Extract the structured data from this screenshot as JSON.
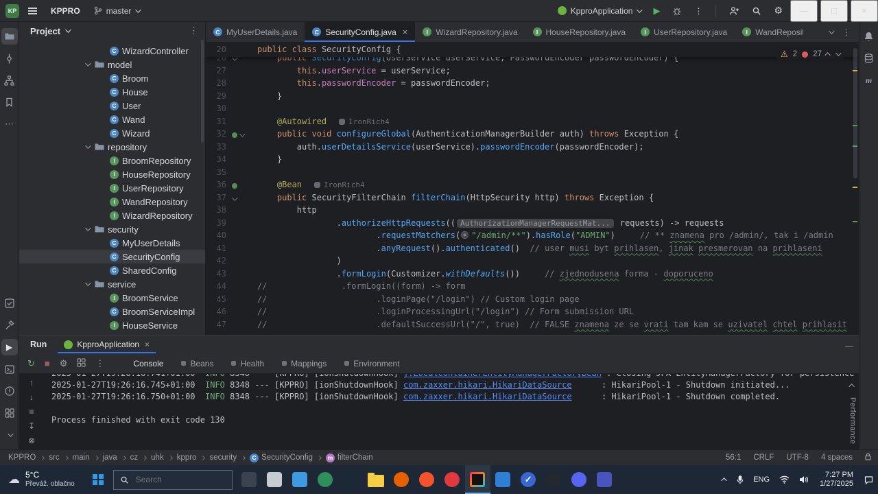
{
  "titlebar": {
    "logo": "KP",
    "project": "KPPRO",
    "branch": "master",
    "run_config": "KpproApplication"
  },
  "left_stripe": {
    "top": [
      "project",
      "commit",
      "structure",
      "bookmarks",
      "more"
    ],
    "bottom": [
      "todo",
      "build",
      "run",
      "terminal",
      "problems",
      "services",
      "hide"
    ]
  },
  "right_stripe": [
    "notifications",
    "database",
    "maven"
  ],
  "project_panel": {
    "title": "Project",
    "tree": [
      {
        "label": "WizardController",
        "icon": "class",
        "level": 2
      },
      {
        "label": "model",
        "icon": "folder",
        "level": 1,
        "expanded": true
      },
      {
        "label": "Broom",
        "icon": "class",
        "level": 2
      },
      {
        "label": "House",
        "icon": "class",
        "level": 2
      },
      {
        "label": "User",
        "icon": "class",
        "level": 2
      },
      {
        "label": "Wand",
        "icon": "class",
        "level": 2
      },
      {
        "label": "Wizard",
        "icon": "class",
        "level": 2
      },
      {
        "label": "repository",
        "icon": "folder",
        "level": 1,
        "expanded": true
      },
      {
        "label": "BroomRepository",
        "icon": "interface",
        "level": 2
      },
      {
        "label": "HouseRepository",
        "icon": "interface",
        "level": 2
      },
      {
        "label": "UserRepository",
        "icon": "interface",
        "level": 2
      },
      {
        "label": "WandRepository",
        "icon": "interface",
        "level": 2
      },
      {
        "label": "WizardRepository",
        "icon": "interface",
        "level": 2
      },
      {
        "label": "security",
        "icon": "folder",
        "level": 1,
        "expanded": true
      },
      {
        "label": "MyUserDetails",
        "icon": "class",
        "level": 2
      },
      {
        "label": "SecurityConfig",
        "icon": "class",
        "level": 2,
        "selected": true
      },
      {
        "label": "SharedConfig",
        "icon": "class",
        "level": 2
      },
      {
        "label": "service",
        "icon": "folder",
        "level": 1,
        "expanded": true
      },
      {
        "label": "BroomService",
        "icon": "interface",
        "level": 2
      },
      {
        "label": "BroomServiceImpl",
        "icon": "class",
        "level": 2
      },
      {
        "label": "HouseService",
        "icon": "interface",
        "level": 2
      }
    ]
  },
  "editor": {
    "tabs": [
      {
        "label": "MyUserDetails.java",
        "icon": "class"
      },
      {
        "label": "SecurityConfig.java",
        "icon": "class",
        "active": true,
        "close": true
      },
      {
        "label": "WizardRepository.java",
        "icon": "interface"
      },
      {
        "label": "HouseRepository.java",
        "icon": "interface"
      },
      {
        "label": "UserRepository.java",
        "icon": "interface"
      },
      {
        "label": "WandRepository.java",
        "icon": "interface",
        "clipped": true
      }
    ],
    "inspections": {
      "warnings": "2",
      "errors": "27"
    },
    "sticky": {
      "num": "20",
      "segs": [
        [
          "k",
          "public"
        ],
        [
          "d",
          " "
        ],
        [
          "k",
          "class"
        ],
        [
          "d",
          " SecurityConfig {"
        ]
      ]
    },
    "lines": [
      {
        "num": "26",
        "gutter": [
          "fold"
        ],
        "segs": [
          [
            "d",
            "    "
          ],
          [
            "k",
            "public"
          ],
          [
            "d",
            " "
          ],
          [
            "m",
            "SecurityConfig"
          ],
          [
            "d",
            "("
          ],
          [
            "t",
            "UserService"
          ],
          [
            "d",
            " userService, "
          ],
          [
            "t",
            "PasswordEncoder"
          ],
          [
            "d",
            " passwordEncoder) {"
          ]
        ]
      },
      {
        "num": "27",
        "segs": [
          [
            "d",
            "        "
          ],
          [
            "k",
            "this"
          ],
          [
            "d",
            "."
          ],
          [
            "f",
            "userService"
          ],
          [
            "d",
            " = userService;"
          ]
        ]
      },
      {
        "num": "28",
        "segs": [
          [
            "d",
            "        "
          ],
          [
            "k",
            "this"
          ],
          [
            "d",
            "."
          ],
          [
            "f",
            "passwordEncoder"
          ],
          [
            "d",
            " = passwordEncoder;"
          ]
        ]
      },
      {
        "num": "29",
        "segs": [
          [
            "d",
            "    }"
          ]
        ]
      },
      {
        "num": "30",
        "segs": []
      },
      {
        "num": "31",
        "author": "IronRich4",
        "segs": [
          [
            "d",
            "    "
          ],
          [
            "a",
            "@Autowired"
          ]
        ]
      },
      {
        "num": "32",
        "gutter": [
          "bean",
          "fold"
        ],
        "segs": [
          [
            "d",
            "    "
          ],
          [
            "k",
            "public"
          ],
          [
            "d",
            " "
          ],
          [
            "k",
            "void"
          ],
          [
            "d",
            " "
          ],
          [
            "m",
            "configureGlobal"
          ],
          [
            "d",
            "("
          ],
          [
            "t",
            "AuthenticationManagerBuilder"
          ],
          [
            "d",
            " auth) "
          ],
          [
            "k",
            "throws"
          ],
          [
            "d",
            " "
          ],
          [
            "t",
            "Exception"
          ],
          [
            "d",
            " {"
          ]
        ]
      },
      {
        "num": "33",
        "segs": [
          [
            "d",
            "        auth."
          ],
          [
            "m",
            "userDetailsService"
          ],
          [
            "d",
            "(userService)."
          ],
          [
            "m",
            "passwordEncoder"
          ],
          [
            "d",
            "(passwordEncoder);"
          ]
        ]
      },
      {
        "num": "34",
        "segs": [
          [
            "d",
            "    }"
          ]
        ]
      },
      {
        "num": "35",
        "segs": []
      },
      {
        "num": "36",
        "author": "IronRich4",
        "gutter": [
          "bean"
        ],
        "segs": [
          [
            "d",
            "    "
          ],
          [
            "a",
            "@Bean"
          ]
        ]
      },
      {
        "num": "37",
        "gutter": [
          "fold"
        ],
        "segs": [
          [
            "d",
            "    "
          ],
          [
            "k",
            "public"
          ],
          [
            "d",
            " "
          ],
          [
            "t",
            "SecurityFilterChain"
          ],
          [
            "d",
            " "
          ],
          [
            "m",
            "filterChain"
          ],
          [
            "d",
            "("
          ],
          [
            "t",
            "HttpSecurity"
          ],
          [
            "d",
            " http) "
          ],
          [
            "k",
            "throws"
          ],
          [
            "d",
            " "
          ],
          [
            "t",
            "Exception"
          ],
          [
            "d",
            " {"
          ]
        ]
      },
      {
        "num": "38",
        "segs": [
          [
            "d",
            "        http"
          ]
        ]
      },
      {
        "num": "39",
        "segs": [
          [
            "d",
            "                ."
          ],
          [
            "m",
            "authorizeHttpRequests"
          ],
          [
            "d",
            "(("
          ],
          [
            "hint",
            "AuthorizationManagerRequestMat..."
          ],
          [
            "d",
            " requests) -> requests"
          ]
        ]
      },
      {
        "num": "40",
        "segs": [
          [
            "d",
            "                        ."
          ],
          [
            "m",
            "requestMatchers"
          ],
          [
            "d",
            "("
          ],
          [
            "url",
            ""
          ],
          [
            "s",
            "\"/admin/**\""
          ],
          [
            "d",
            ")."
          ],
          [
            "m",
            "hasRole"
          ],
          [
            "d",
            "("
          ],
          [
            "s",
            "\"ADMIN\""
          ],
          [
            "d",
            ")     "
          ],
          [
            "c",
            "// ** "
          ],
          [
            "cu",
            "znamena"
          ],
          [
            "c",
            " pro /admin/, tak i /admin"
          ]
        ]
      },
      {
        "num": "41",
        "segs": [
          [
            "d",
            "                        ."
          ],
          [
            "m",
            "anyRequest"
          ],
          [
            "d",
            "()."
          ],
          [
            "m",
            "authenticated"
          ],
          [
            "d",
            "()  "
          ],
          [
            "c",
            "// user "
          ],
          [
            "cu",
            "musi"
          ],
          [
            "c",
            " byt "
          ],
          [
            "cu",
            "prihlasen"
          ],
          [
            "c",
            ", "
          ],
          [
            "cu",
            "jinak"
          ],
          [
            "c",
            " "
          ],
          [
            "cu",
            "presmerovan"
          ],
          [
            "c",
            " na "
          ],
          [
            "cu",
            "prihlaseni"
          ]
        ]
      },
      {
        "num": "42",
        "segs": [
          [
            "d",
            "                )"
          ]
        ]
      },
      {
        "num": "43",
        "segs": [
          [
            "d",
            "                ."
          ],
          [
            "m",
            "formLogin"
          ],
          [
            "d",
            "("
          ],
          [
            "t",
            "Customizer"
          ],
          [
            "d",
            "."
          ],
          [
            "ms",
            "withDefaults"
          ],
          [
            "d",
            "())     "
          ],
          [
            "c",
            "// "
          ],
          [
            "cu",
            "zjednodusena"
          ],
          [
            "c",
            " forma - "
          ],
          [
            "cu",
            "doporuceno"
          ]
        ]
      },
      {
        "num": "44",
        "segs": [
          [
            "c",
            "//               .formLogin((form) -> form"
          ]
        ]
      },
      {
        "num": "45",
        "segs": [
          [
            "c",
            "//                      .loginPage(\"/login\") // Custom login page"
          ]
        ]
      },
      {
        "num": "46",
        "segs": [
          [
            "c",
            "//                      .loginProcessingUrl(\"/login\") // Form submission URL"
          ]
        ]
      },
      {
        "num": "47",
        "segs": [
          [
            "c",
            "//                      .defaultSuccessUrl(\"/\", true)  // FALSE "
          ],
          [
            "cu",
            "znamena"
          ],
          [
            "c",
            " ze se "
          ],
          [
            "cu",
            "vrati"
          ],
          [
            "c",
            " tam kam se "
          ],
          [
            "cu",
            "uzivatel"
          ],
          [
            "c",
            " "
          ],
          [
            "cu",
            "chtel"
          ],
          [
            "c",
            " "
          ],
          [
            "cu",
            "prihlasit"
          ]
        ]
      }
    ]
  },
  "run_panel": {
    "label": "Run",
    "tab": "KpproApplication",
    "tabs": [
      {
        "label": "Console",
        "active": true
      },
      {
        "label": "Beans",
        "dot": true
      },
      {
        "label": "Health",
        "dot": true
      },
      {
        "label": "Mappings",
        "dot": true
      },
      {
        "label": "Environment",
        "dot": true
      }
    ],
    "performance_label": "Performance",
    "console": [
      {
        "clip": true,
        "segs": [
          [
            "t",
            "2025-01-27T19:26:16.741+01:00  "
          ],
          [
            "i",
            "INFO"
          ],
          [
            "t",
            " 8348 --- [KPPRO] [ionShutdownHook] "
          ],
          [
            "l",
            "j.LocalContainerEntityManagerFactoryBean"
          ],
          [
            "t",
            " : Closing JPA EntityManagerFactory for persistence unit 'default'"
          ]
        ]
      },
      {
        "segs": [
          [
            "t",
            "2025-01-27T19:26:16.745+01:00  "
          ],
          [
            "i",
            "INFO"
          ],
          [
            "t",
            " 8348 --- [KPPRO] [ionShutdownHook] "
          ],
          [
            "l",
            "com.zaxxer.hikari.HikariDataSource"
          ],
          [
            "t",
            "      : HikariPool-1 - Shutdown initiated..."
          ]
        ]
      },
      {
        "segs": [
          [
            "t",
            "2025-01-27T19:26:16.750+01:00  "
          ],
          [
            "i",
            "INFO"
          ],
          [
            "t",
            " 8348 --- [KPPRO] [ionShutdownHook] "
          ],
          [
            "l",
            "com.zaxxer.hikari.HikariDataSource"
          ],
          [
            "t",
            "      : HikariPool-1 - Shutdown completed."
          ]
        ]
      },
      {
        "segs": []
      },
      {
        "segs": [
          [
            "t",
            "Process finished with exit code 130"
          ]
        ]
      }
    ]
  },
  "status_bar": {
    "breadcrumbs": [
      {
        "label": "KPPRO"
      },
      {
        "label": "src"
      },
      {
        "label": "main"
      },
      {
        "label": "java"
      },
      {
        "label": "cz"
      },
      {
        "label": "uhk"
      },
      {
        "label": "kppro"
      },
      {
        "label": "security"
      },
      {
        "label": "SecurityConfig",
        "icon": "class"
      },
      {
        "label": "filterChain",
        "icon": "method"
      }
    ],
    "right": [
      "56:1",
      "CRLF",
      "UTF-8",
      "4 spaces"
    ]
  },
  "taskbar": {
    "weather": {
      "temp": "5°C",
      "desc": "Převáž. oblačno"
    },
    "search_placeholder": "Search",
    "apps": [
      {
        "name": "remote-desktop",
        "kind": "square",
        "color": "#3b4350"
      },
      {
        "name": "camera-app",
        "kind": "square",
        "color": "#c7ccd3"
      },
      {
        "name": "mail-app",
        "kind": "square",
        "color": "#3f9be0"
      },
      {
        "name": "recorder-app",
        "kind": "circle",
        "color": "#2f8f5b"
      },
      {
        "name": "steam",
        "kind": "circle",
        "color": "#1b2838"
      },
      {
        "name": "file-explorer",
        "kind": "folder",
        "color": "#f6ce46"
      },
      {
        "name": "firefox",
        "kind": "circle",
        "color": "#e66000"
      },
      {
        "name": "brave",
        "kind": "circle",
        "color": "#f3542d"
      },
      {
        "name": "opera",
        "kind": "circle",
        "color": "#e0393e"
      },
      {
        "name": "intellij-idea",
        "kind": "ij",
        "color": "#121212",
        "active": true
      },
      {
        "name": "photos-app",
        "kind": "square",
        "color": "#2f7fd4"
      },
      {
        "name": "todo-app",
        "kind": "check",
        "color": "#3a66d1",
        "glyph": "✓"
      },
      {
        "name": "github-desktop",
        "kind": "circle",
        "color": "#23272e"
      },
      {
        "name": "discord",
        "kind": "circle",
        "color": "#5865f2"
      },
      {
        "name": "teams",
        "kind": "square",
        "color": "#4b53bc"
      }
    ],
    "tray": {
      "lang": "ENG",
      "time": "7:27 PM",
      "date": "1/27/2025"
    }
  }
}
